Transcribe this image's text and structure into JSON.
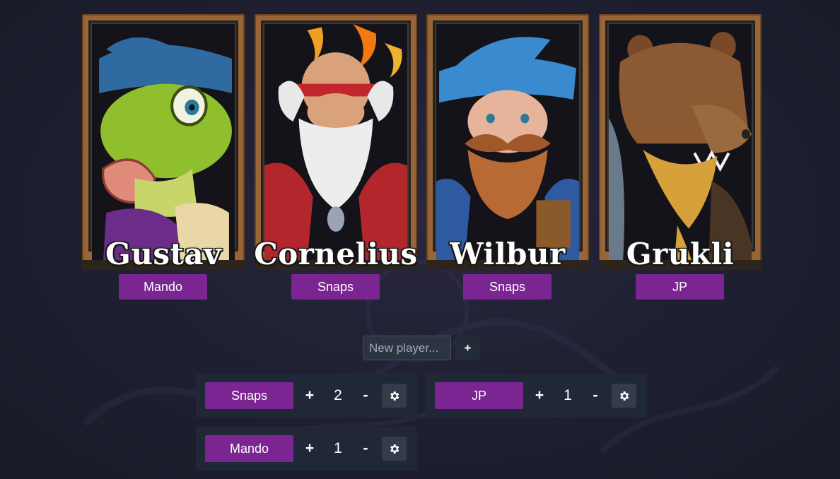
{
  "characters": [
    {
      "name": "Gustav",
      "player": "Mando",
      "portrait_icon": "frog-wizard-portrait"
    },
    {
      "name": "Cornelius",
      "player": "Snaps",
      "portrait_icon": "old-monk-portrait"
    },
    {
      "name": "Wilbur",
      "player": "Snaps",
      "portrait_icon": "dwarf-wizard-portrait"
    },
    {
      "name": "Grukli",
      "player": "JP",
      "portrait_icon": "bear-warrior-portrait"
    }
  ],
  "new_player": {
    "placeholder": "New player...",
    "add_label": "+"
  },
  "scoreboard": [
    {
      "name": "Snaps",
      "plus": "+",
      "score": "2",
      "minus": "-",
      "settings_icon": "gear-icon"
    },
    {
      "name": "JP",
      "plus": "+",
      "score": "1",
      "minus": "-",
      "settings_icon": "gear-icon"
    },
    {
      "name": "Mando",
      "plus": "+",
      "score": "1",
      "minus": "-",
      "settings_icon": "gear-icon"
    }
  ],
  "colors": {
    "background": "#1f2133",
    "player_button": "#7a2592",
    "panel": "#202838",
    "card_frame": "#9a6536"
  }
}
